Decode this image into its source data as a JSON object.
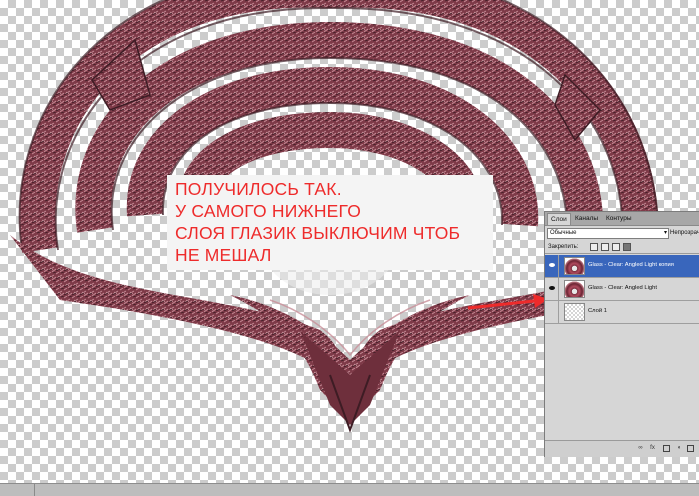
{
  "annotation": {
    "lines": [
      "ПОЛУЧИЛОСЬ ТАК.",
      "У САМОГО НИЖНЕГО",
      "СЛОЯ ГЛАЗИК ВЫКЛЮЧИМ ЧТОБ",
      "НЕ МЕШАЛ"
    ],
    "color": "#ee2b2b"
  },
  "layers_panel": {
    "tabs": [
      "Слои",
      "Каналы",
      "Контуры"
    ],
    "active_tab": "Слои",
    "blend_mode": "Обычные",
    "opacity_label": "Непрозрачн",
    "lock_label": "Закрепить:",
    "layers": [
      {
        "name": "Glass - Clear: Angled Light копия",
        "visible": true,
        "selected": true,
        "thumb": "art"
      },
      {
        "name": "Glass - Clear: Angled Light",
        "visible": true,
        "selected": false,
        "thumb": "art"
      },
      {
        "name": "Слой 1",
        "visible": false,
        "selected": false,
        "thumb": "empty"
      }
    ],
    "bottom_icons": [
      "link-icon",
      "fx-icon",
      "mask-icon",
      "adjustment-icon"
    ]
  },
  "colors": {
    "artwork_primary": "#7e3a48",
    "artwork_highlight": "#c88f99",
    "selection": "#3966bc",
    "arrow": "#ee2b2b"
  }
}
